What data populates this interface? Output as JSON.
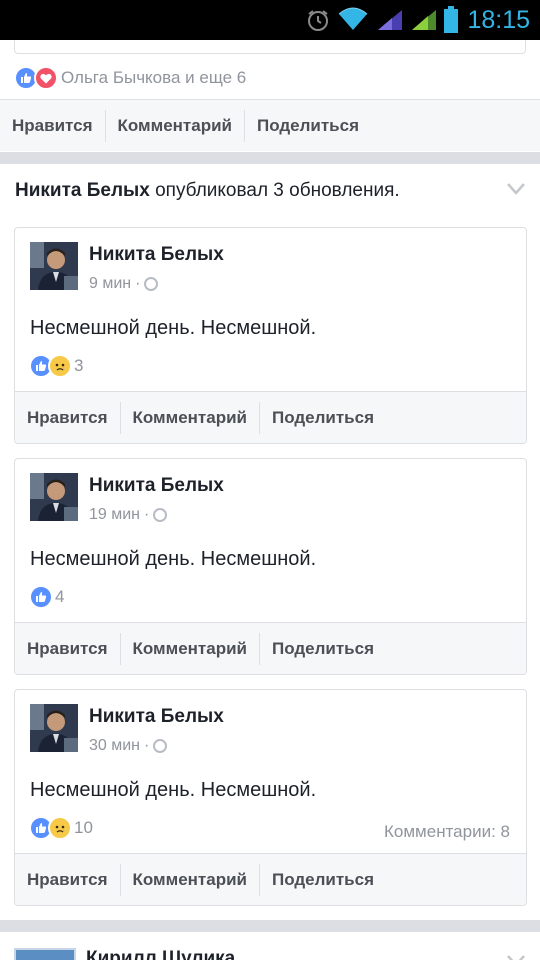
{
  "status_bar": {
    "time": "18:15",
    "icons": [
      "alarm-icon",
      "wifi-icon",
      "signal-icon",
      "signal-icon",
      "battery-icon"
    ]
  },
  "top_post": {
    "reactions_text": "Ольга Бычкова и еще 6",
    "actions": {
      "like": "Нравится",
      "comment": "Комментарий",
      "share": "Поделиться"
    }
  },
  "story": {
    "author": "Никита Белых",
    "header_rest": "опубликовал 3 обновления.",
    "posts": [
      {
        "author": "Никита Белых",
        "time": "9 мин",
        "text": "Несмешной день. Несмешной.",
        "reaction_count": "3",
        "comments": "",
        "actions": {
          "like": "Нравится",
          "comment": "Комментарий",
          "share": "Поделиться"
        }
      },
      {
        "author": "Никита Белых",
        "time": "19 мин",
        "text": "Несмешной день. Несмешной.",
        "reaction_count": "4",
        "comments": "",
        "actions": {
          "like": "Нравится",
          "comment": "Комментарий",
          "share": "Поделиться"
        }
      },
      {
        "author": "Никита Белых",
        "time": "30 мин",
        "text": "Несмешной день. Несмешной.",
        "reaction_count": "10",
        "comments": "Комментарии: 8",
        "actions": {
          "like": "Нравится",
          "comment": "Комментарий",
          "share": "Поделиться"
        }
      }
    ]
  },
  "next_story": {
    "author": "Кирилл Шулика"
  },
  "colors": {
    "like_blue": "#5890ff",
    "love_red": "#f25268",
    "sad_yellow": "#f7c948",
    "status_blue": "#33b5e5"
  }
}
